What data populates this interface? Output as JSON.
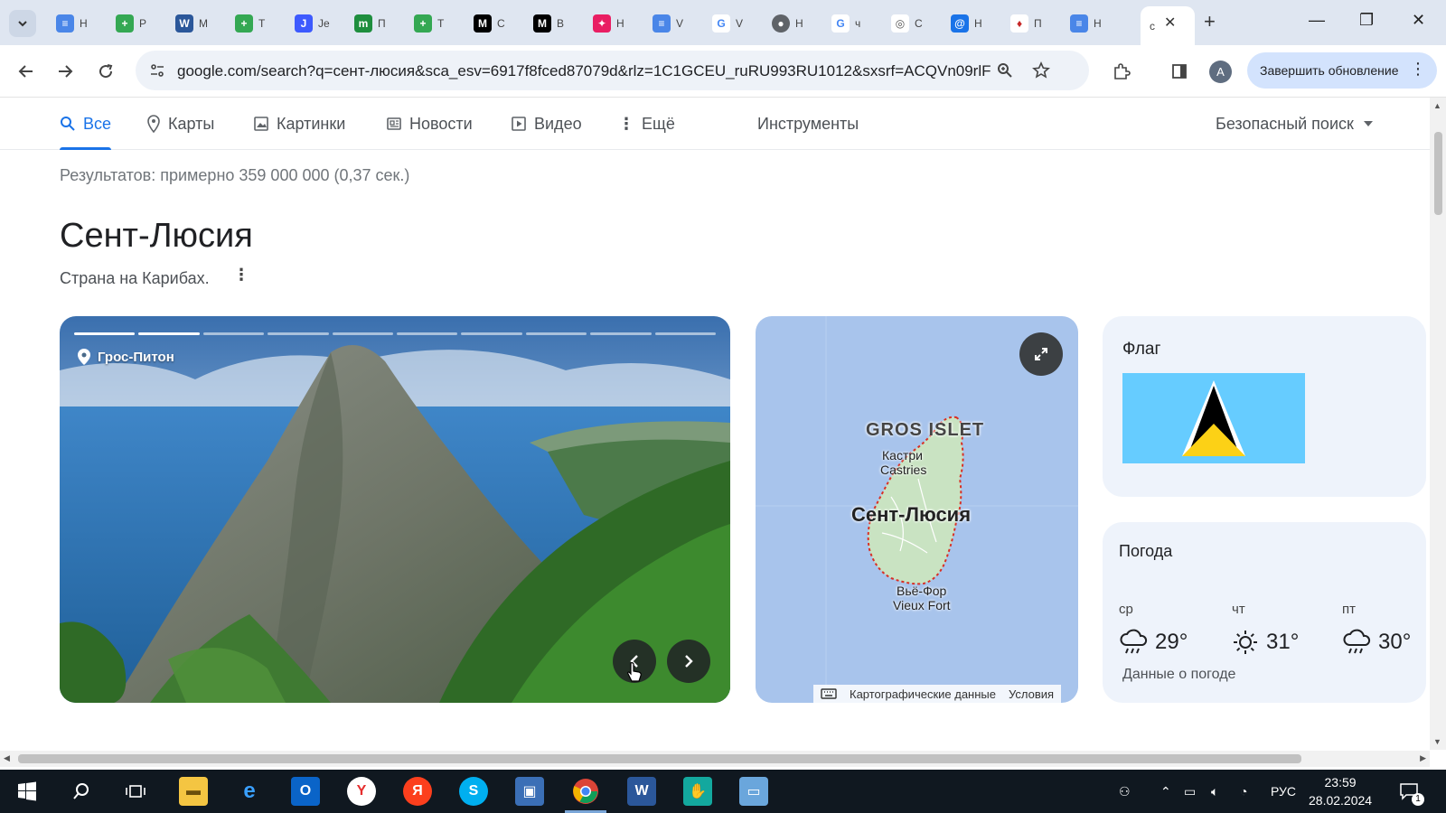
{
  "browser": {
    "tabs": [
      {
        "title": "Н",
        "favicon": "doc-icon",
        "color": "#4a86e8"
      },
      {
        "title": "Р",
        "favicon": "sheets-plus-icon",
        "color": "#34a853"
      },
      {
        "title": "М",
        "favicon": "word-icon",
        "color": "#2b579a"
      },
      {
        "title": "Т",
        "favicon": "sheets-plus-icon",
        "color": "#34a853"
      },
      {
        "title": "Je",
        "favicon": "blue-round-icon",
        "color": "#3d5afe"
      },
      {
        "title": "П",
        "favicon": "green-m-icon",
        "color": "#1e8e3e"
      },
      {
        "title": "Т",
        "favicon": "sheets-plus-icon",
        "color": "#34a853"
      },
      {
        "title": "С",
        "favicon": "black-m-icon",
        "color": "#000000"
      },
      {
        "title": "В",
        "favicon": "black-m-icon",
        "color": "#000000"
      },
      {
        "title": "Н",
        "favicon": "pink-puzzle-icon",
        "color": "#e91e63"
      },
      {
        "title": "V",
        "favicon": "doc-icon",
        "color": "#4a86e8"
      },
      {
        "title": "V",
        "favicon": "google-icon",
        "color": "#ffffff"
      },
      {
        "title": "Н",
        "favicon": "chrome-gray-icon",
        "color": "#5f6368"
      },
      {
        "title": "ч",
        "favicon": "google-icon",
        "color": "#ffffff"
      },
      {
        "title": "С",
        "favicon": "eye-icon",
        "color": "#ffffff"
      },
      {
        "title": "Н",
        "favicon": "at-sign-icon",
        "color": "#1a73e8"
      },
      {
        "title": "П",
        "favicon": "red-gem-icon",
        "color": "#ffffff"
      },
      {
        "title": "Н",
        "favicon": "doc-icon",
        "color": "#4a86e8"
      },
      {
        "title": "c",
        "favicon": "none",
        "color": "#ffffff"
      }
    ],
    "url": "google.com/search?q=сент-люсия&sca_esv=6917f8fced87079d&rlz=1C1GCEU_ruRU993RU1012&sxsrf=ACQVn09rlF...",
    "profile_letter": "A",
    "update_label": "Завершить обновление"
  },
  "search_tabs": [
    {
      "label": "Все",
      "icon": "search-icon",
      "active": true
    },
    {
      "label": "Карты",
      "icon": "location-pin-icon"
    },
    {
      "label": "Картинки",
      "icon": "image-icon"
    },
    {
      "label": "Новости",
      "icon": "newspaper-icon"
    },
    {
      "label": "Видео",
      "icon": "play-icon"
    },
    {
      "label": "Ещё",
      "icon": "more-vertical-icon"
    }
  ],
  "tools_label": "Инструменты",
  "safe_search_label": "Безопасный поиск",
  "result_stats": "Результатов: примерно 359 000 000 (0,37 сек.)",
  "entity": {
    "title": "Сент-Люсия",
    "subtitle": "Страна на Карибах."
  },
  "photo": {
    "caption": "Грос-Питон",
    "segments_total": 10,
    "segments_active": 2
  },
  "map": {
    "labels": {
      "gros_islet": "GROS ISLET",
      "castries_ru": "Кастри",
      "castries_en": "Castries",
      "country": "Сент-Люсия",
      "vieux_fort_ru": "Вьё-Фор",
      "vieux_fort_en": "Vieux Fort"
    },
    "attribution": "Картографические данные",
    "terms": "Условия"
  },
  "flag_card": {
    "title": "Флаг"
  },
  "weather": {
    "title": "Погода",
    "days": [
      {
        "day": "ср",
        "temp": "29°",
        "icon": "rain-cloud-icon"
      },
      {
        "day": "чт",
        "temp": "31°",
        "icon": "sun-icon"
      },
      {
        "day": "пт",
        "temp": "30°",
        "icon": "rain-cloud-icon"
      }
    ],
    "source": "Данные о погоде"
  },
  "taskbar": {
    "language": "РУС",
    "time": "23:59",
    "date": "28.02.2024",
    "notifications": "1"
  }
}
